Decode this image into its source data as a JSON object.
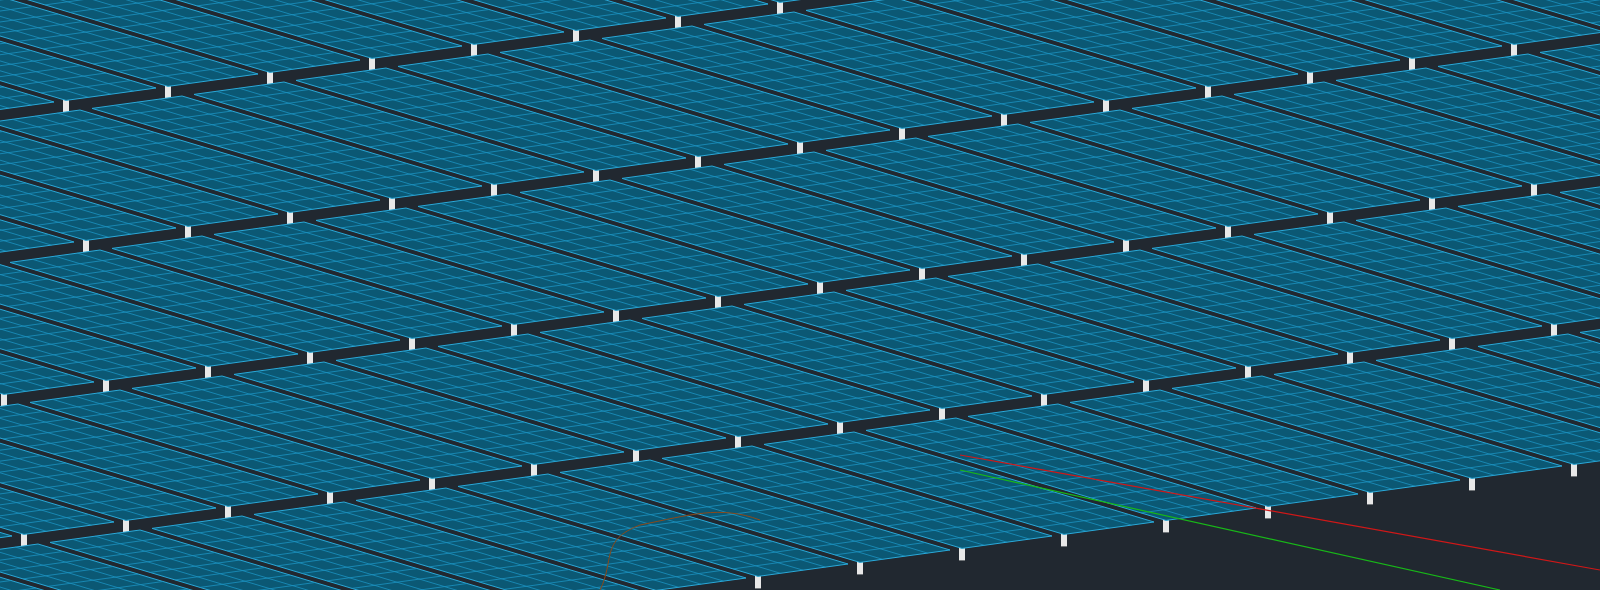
{
  "scene": {
    "kind": "solar-array"
  },
  "survey_lines": [
    {
      "color": "#d01818"
    },
    {
      "color": "#18b818"
    }
  ]
}
